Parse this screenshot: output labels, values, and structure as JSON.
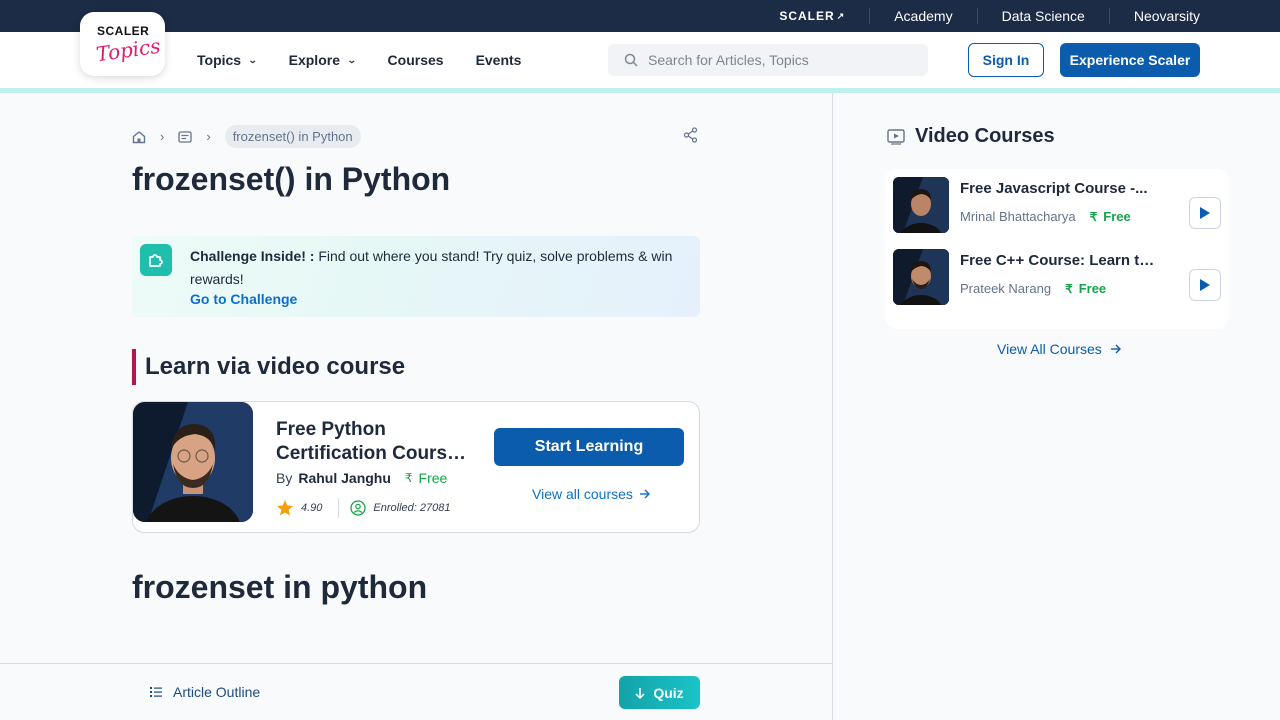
{
  "topbar": {
    "brand": "SCALER",
    "links": [
      "Academy",
      "Data Science",
      "Neovarsity"
    ]
  },
  "logo": {
    "line1": "SCALER",
    "line2": "Topics"
  },
  "nav": {
    "items": [
      {
        "label": "Topics",
        "dropdown": true
      },
      {
        "label": "Explore",
        "dropdown": true
      },
      {
        "label": "Courses",
        "dropdown": false
      },
      {
        "label": "Events",
        "dropdown": false
      }
    ]
  },
  "search": {
    "placeholder": "Search for Articles, Topics",
    "icon": "search-icon"
  },
  "auth": {
    "signin": "Sign In",
    "experience": "Experience Scaler"
  },
  "breadcrumb": {
    "current": "frozenset() in Python"
  },
  "article": {
    "title": "frozenset() in Python",
    "section_title": "frozenset in python"
  },
  "challenge": {
    "label": "Challenge Inside! :",
    "text": "Find out where you stand! Try quiz, solve problems & win rewards!",
    "link": "Go to Challenge"
  },
  "learn_video": {
    "heading": "Learn via video course",
    "course": {
      "title_line1": "Free Python",
      "title_line2": "Certification Course:...",
      "by": "By",
      "author": "Rahul Janghu",
      "price": "Free",
      "rating": "4.90",
      "enrolled": "Enrolled: 27081",
      "cta": "Start Learning",
      "view_all": "View all courses"
    }
  },
  "bottom": {
    "outline": "Article Outline",
    "quiz": "Quiz"
  },
  "video_courses": {
    "heading": "Video Courses",
    "items": [
      {
        "title": "Free Javascript Course -...",
        "author": "Mrinal Bhattacharya",
        "price": "Free"
      },
      {
        "title": "Free C++ Course: Learn th...",
        "author": "Prateek Narang",
        "price": "Free"
      }
    ],
    "view_all": "View All Courses"
  },
  "colors": {
    "primary": "#0b5cad",
    "topbar": "#1c2b46",
    "accent_teal": "#1fbfae",
    "free_green": "#16a34a",
    "heading_bar": "#b5164f"
  }
}
